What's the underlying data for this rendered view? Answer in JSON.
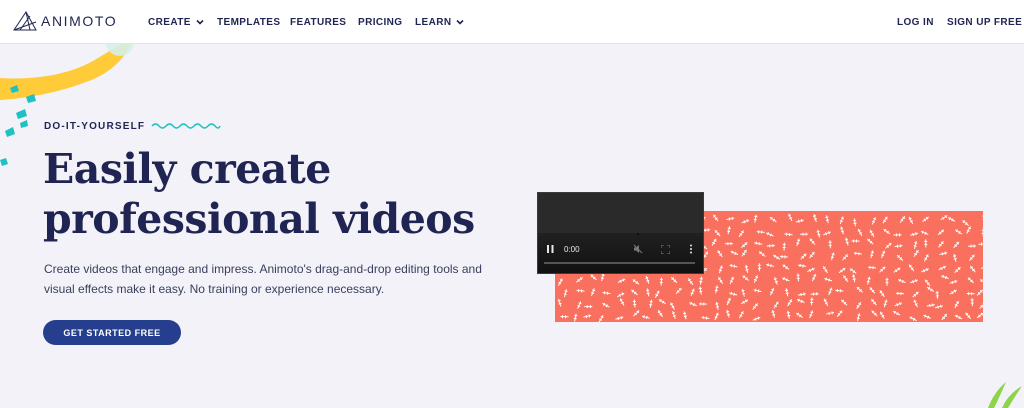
{
  "header": {
    "logo_text": "ANIMOTO",
    "nav": [
      {
        "label": "CREATE",
        "has_dropdown": true
      },
      {
        "label": "TEMPLATES",
        "has_dropdown": false
      },
      {
        "label": "FEATURES",
        "has_dropdown": false
      },
      {
        "label": "PRICING",
        "has_dropdown": false
      },
      {
        "label": "LEARN",
        "has_dropdown": true
      }
    ],
    "login_label": "LOG IN",
    "signup_label": "SIGN UP FREE"
  },
  "hero": {
    "eyebrow": "DO-IT-YOURSELF",
    "title_line1": "Easily create",
    "title_line2": "professional videos",
    "description": "Create videos that engage and impress. Animoto's drag-and-drop editing tools and visual effects make it easy. No training or experience necessary.",
    "cta_label": "GET STARTED FREE"
  },
  "video": {
    "time": "0:00",
    "state": "loading"
  },
  "colors": {
    "navy": "#1f2452",
    "cta_blue": "#253f8e",
    "coral": "#f9705e",
    "teal": "#1fc1c3",
    "yellow": "#ffcb38",
    "pink": "#ee3d6d",
    "background": "#f2f2f8"
  },
  "icons": [
    "animoto-logo-icon",
    "chevron-down-icon",
    "wavy-line-icon",
    "pause-icon",
    "loading-spinner-icon",
    "mute-icon",
    "fullscreen-icon",
    "more-vertical-icon"
  ]
}
